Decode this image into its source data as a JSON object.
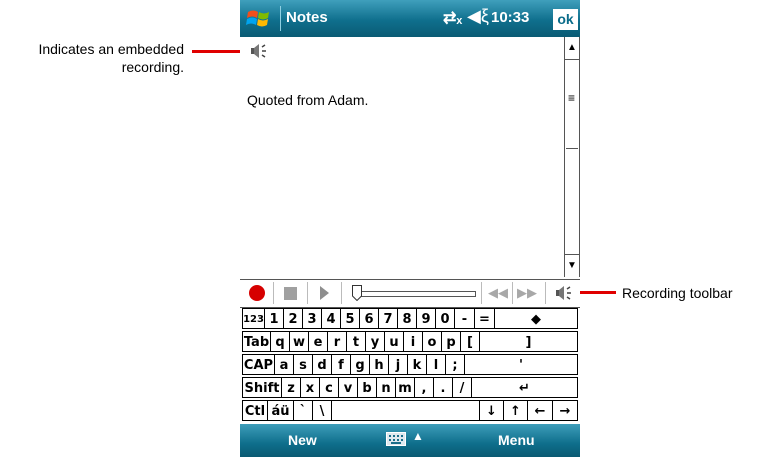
{
  "annotations": {
    "embedded_recording": "Indicates an embedded recording.",
    "recording_toolbar": "Recording toolbar"
  },
  "titlebar": {
    "app_title": "Notes",
    "time": "10:33",
    "ok_label": "ok",
    "connectivity_icon": "connectivity-icon",
    "volume_icon": "volume-icon"
  },
  "note": {
    "text": "Quoted from Adam.",
    "embedded_icon": "speaker-icon"
  },
  "recording_toolbar": {
    "buttons": [
      "record",
      "stop",
      "play",
      "skip-back",
      "skip-forward",
      "recording-toggle"
    ],
    "record_color": "#d60000",
    "position_fraction": 0.0
  },
  "keyboard": {
    "rows": [
      [
        "123",
        "1",
        "2",
        "3",
        "4",
        "5",
        "6",
        "7",
        "8",
        "9",
        "0",
        "-",
        "=",
        "◆"
      ],
      [
        "Tab",
        "q",
        "w",
        "e",
        "r",
        "t",
        "y",
        "u",
        "i",
        "o",
        "p",
        "[",
        "]"
      ],
      [
        "CAP",
        "a",
        "s",
        "d",
        "f",
        "g",
        "h",
        "j",
        "k",
        "l",
        ";",
        "'"
      ],
      [
        "Shift",
        "z",
        "x",
        "c",
        "v",
        "b",
        "n",
        "m",
        ",",
        ".",
        "/",
        "↵"
      ],
      [
        "Ctl",
        "áü",
        "`",
        "\\",
        " ",
        "↓",
        "↑",
        "←",
        "→"
      ]
    ]
  },
  "bottombar": {
    "left_soft_key": "New",
    "right_soft_key": "Menu",
    "input_icon": "keyboard-icon"
  },
  "colors": {
    "titlebar": "#0f6f8d",
    "annotation_line": "#e00000"
  }
}
